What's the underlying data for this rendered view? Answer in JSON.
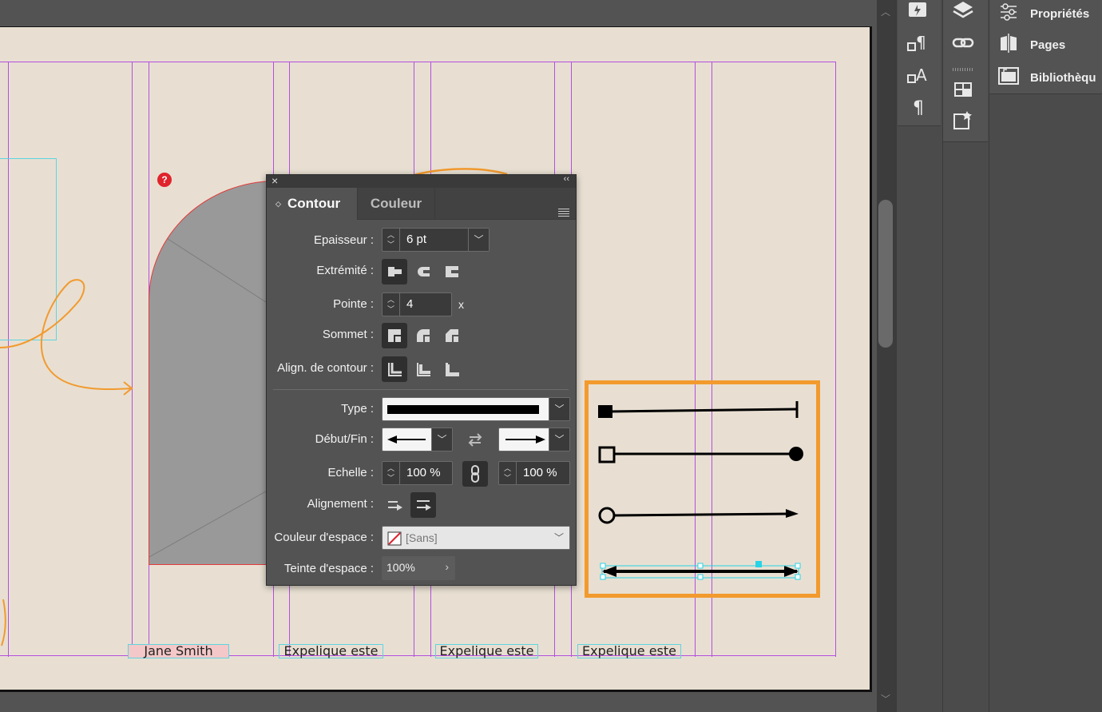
{
  "canvas": {
    "captions": [
      "Jane Smith",
      "Expelique este",
      "Expelique este",
      "Expelique este"
    ],
    "colors": {
      "page": "#e8dfd2",
      "guide": "#b44fe0",
      "frame": "#5fd4e0",
      "accent_box": "#f29a2e",
      "error": "#e0242c"
    },
    "error_badge": "?"
  },
  "stroke_panel": {
    "tabs": [
      {
        "label": "Contour",
        "active": true
      },
      {
        "label": "Couleur",
        "active": false
      }
    ],
    "rows": {
      "weight": {
        "label": "Epaisseur :",
        "value": "6 pt"
      },
      "cap": {
        "label": "Extrémité :"
      },
      "miter": {
        "label": "Pointe :",
        "value": "4",
        "suffix": "x"
      },
      "join": {
        "label": "Sommet :"
      },
      "align_stroke": {
        "label": "Align. de contour :"
      },
      "type": {
        "label": "Type :"
      },
      "start_end": {
        "label": "Début/Fin :"
      },
      "scale": {
        "label": "Echelle :",
        "start_value": "100 %",
        "end_value": "100 %"
      },
      "alignment": {
        "label": "Alignement :"
      },
      "gap_color": {
        "label": "Couleur d'espace :",
        "value": "[Sans]"
      },
      "gap_tint": {
        "label": "Teinte d'espace :",
        "value": "100%"
      }
    }
  },
  "panels": [
    {
      "label": "Propriétés",
      "icon": "sliders-icon"
    },
    {
      "label": "Pages",
      "icon": "pages-icon"
    },
    {
      "label": "Bibliothèqu",
      "icon": "library-icon"
    }
  ]
}
